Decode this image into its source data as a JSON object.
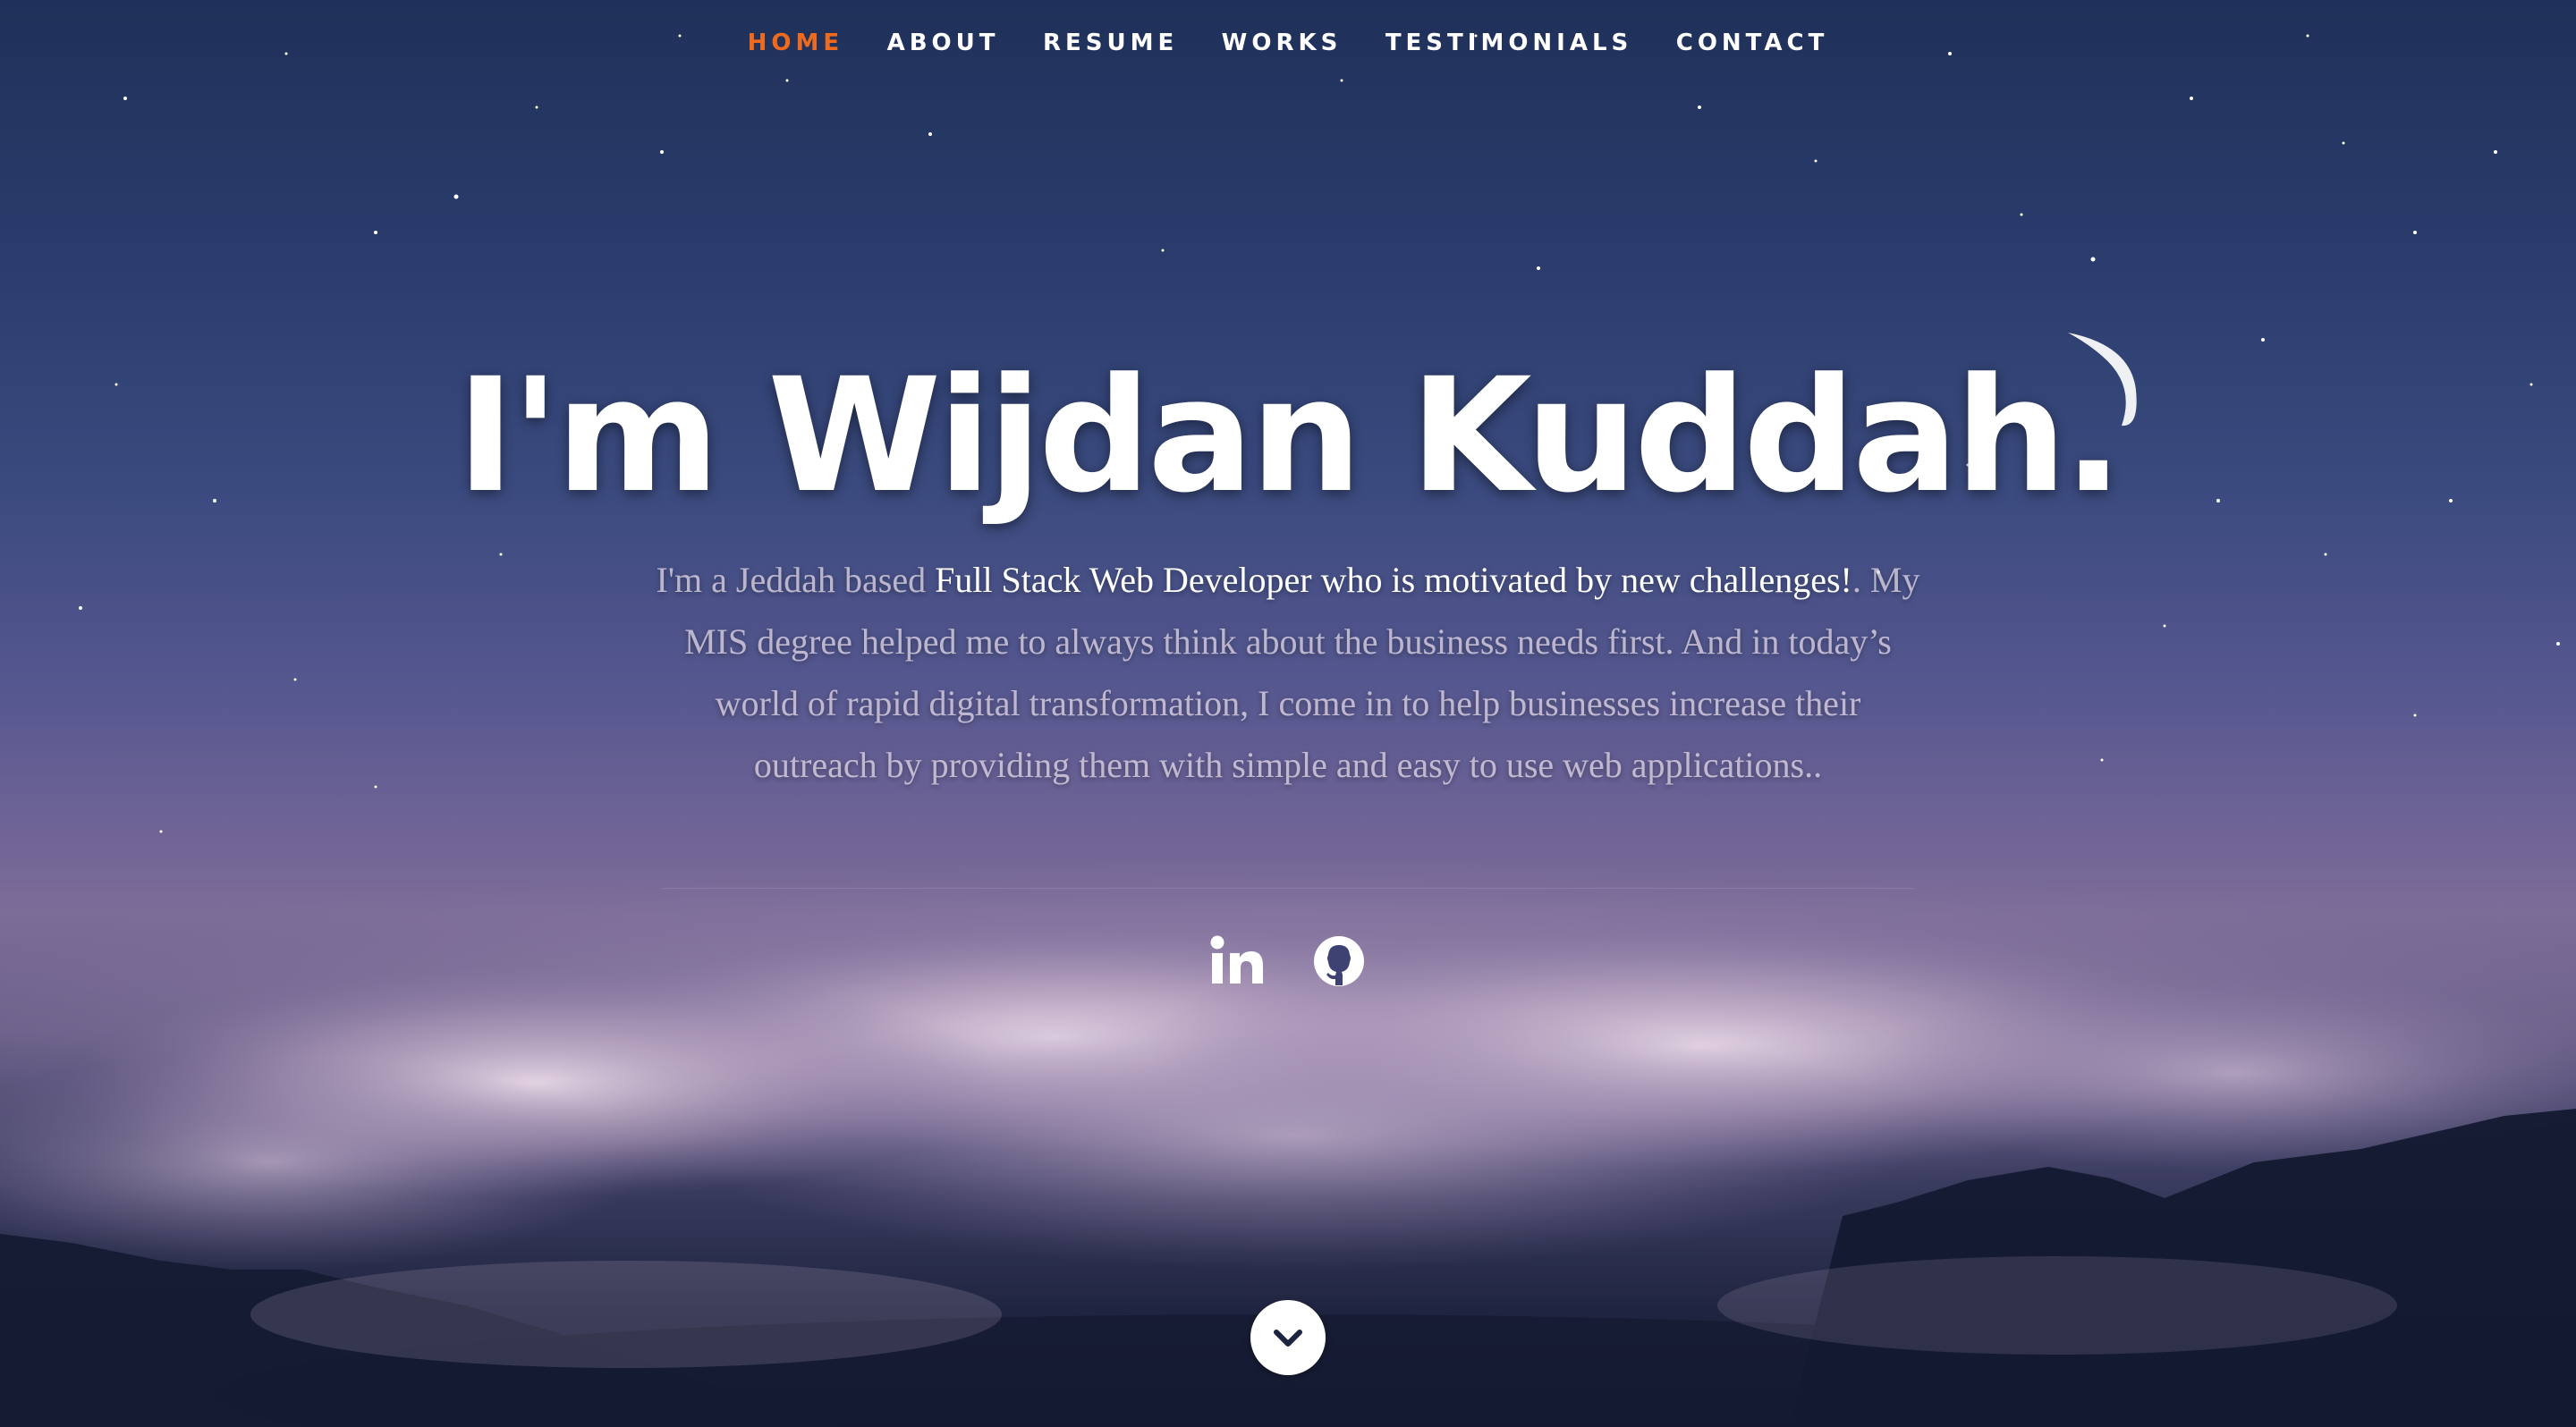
{
  "nav": {
    "items": [
      {
        "label": "HOME",
        "active": true
      },
      {
        "label": "ABOUT",
        "active": false
      },
      {
        "label": "RESUME",
        "active": false
      },
      {
        "label": "WORKS",
        "active": false
      },
      {
        "label": "TESTIMONIALS",
        "active": false
      },
      {
        "label": "CONTACT",
        "active": false
      }
    ]
  },
  "hero": {
    "headline": "I'm Wijdan Kuddah.",
    "bio": {
      "part1": "I'm a Jeddah based ",
      "highlight": "Full Stack Web Developer who is motivated by new challenges!",
      "part2": ". My MIS degree helped me to always think about the business needs first. And in today’s world of rapid digital transformation, I come in to help businesses increase their outreach by providing them with simple and easy to use web applications.."
    }
  },
  "social": [
    {
      "icon": "linkedin-icon"
    },
    {
      "icon": "github-icon"
    }
  ],
  "scroll_down": {
    "icon": "chevron-down-icon"
  },
  "colors": {
    "accent": "#f06a1d",
    "text": "#ffffff",
    "sky_top": "#1f3159",
    "sky_mid": "#55578f",
    "bottom": "#141a30"
  }
}
